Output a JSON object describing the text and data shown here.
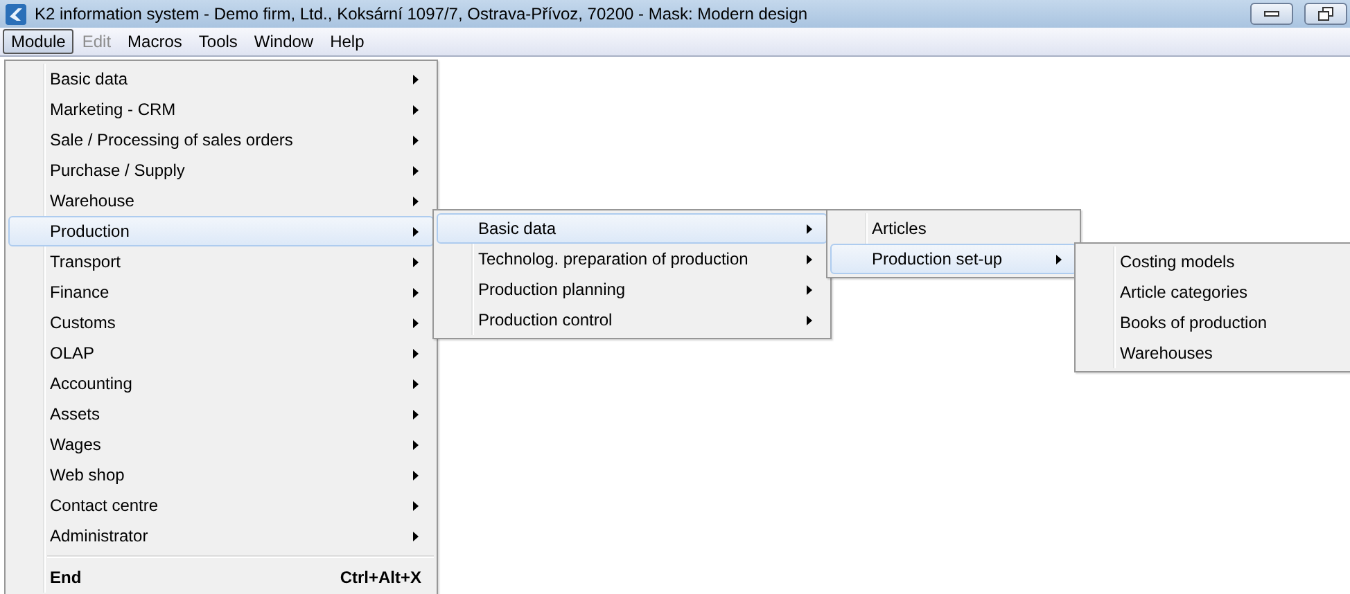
{
  "window": {
    "title": "K2 information system - Demo firm, Ltd., Koksární 1097/7, Ostrava-Přívoz, 70200 -  Mask: Modern design"
  },
  "menubar": [
    {
      "label": "Module",
      "selected": true,
      "disabled": false
    },
    {
      "label": "Edit",
      "selected": false,
      "disabled": true
    },
    {
      "label": "Macros",
      "selected": false,
      "disabled": false
    },
    {
      "label": "Tools",
      "selected": false,
      "disabled": false
    },
    {
      "label": "Window",
      "selected": false,
      "disabled": false
    },
    {
      "label": "Help",
      "selected": false,
      "disabled": false
    }
  ],
  "menus": [
    {
      "items": [
        {
          "kind": "submenu",
          "label": "Basic data",
          "selected": false
        },
        {
          "kind": "submenu",
          "label": "Marketing - CRM",
          "selected": false
        },
        {
          "kind": "submenu",
          "label": "Sale / Processing of sales orders",
          "selected": false
        },
        {
          "kind": "submenu",
          "label": "Purchase / Supply",
          "selected": false
        },
        {
          "kind": "submenu",
          "label": "Warehouse",
          "selected": false
        },
        {
          "kind": "submenu",
          "label": "Production",
          "selected": true
        },
        {
          "kind": "submenu",
          "label": "Transport",
          "selected": false
        },
        {
          "kind": "submenu",
          "label": "Finance",
          "selected": false
        },
        {
          "kind": "submenu",
          "label": "Customs",
          "selected": false
        },
        {
          "kind": "submenu",
          "label": "OLAP",
          "selected": false
        },
        {
          "kind": "submenu",
          "label": "Accounting",
          "selected": false
        },
        {
          "kind": "submenu",
          "label": "Assets",
          "selected": false
        },
        {
          "kind": "submenu",
          "label": "Wages",
          "selected": false
        },
        {
          "kind": "submenu",
          "label": "Web shop",
          "selected": false
        },
        {
          "kind": "submenu",
          "label": "Contact centre",
          "selected": false
        },
        {
          "kind": "submenu",
          "label": "Administrator",
          "selected": false
        },
        {
          "kind": "separator"
        },
        {
          "kind": "command",
          "label": "End",
          "shortcut": "Ctrl+Alt+X",
          "selected": false
        }
      ]
    },
    {
      "items": [
        {
          "kind": "submenu",
          "label": "Basic data",
          "selected": true
        },
        {
          "kind": "submenu",
          "label": "Technolog. preparation of production",
          "selected": false
        },
        {
          "kind": "submenu",
          "label": "Production planning",
          "selected": false
        },
        {
          "kind": "submenu",
          "label": "Production control",
          "selected": false
        }
      ]
    },
    {
      "items": [
        {
          "kind": "item",
          "label": "Articles",
          "selected": false
        },
        {
          "kind": "submenu",
          "label": "Production set-up",
          "selected": true
        }
      ]
    },
    {
      "items": [
        {
          "kind": "item",
          "label": "Costing models",
          "selected": false
        },
        {
          "kind": "item",
          "label": "Article categories",
          "selected": false
        },
        {
          "kind": "item",
          "label": "Books of production",
          "selected": false
        },
        {
          "kind": "item",
          "label": "Warehouses",
          "selected": false
        }
      ]
    }
  ]
}
